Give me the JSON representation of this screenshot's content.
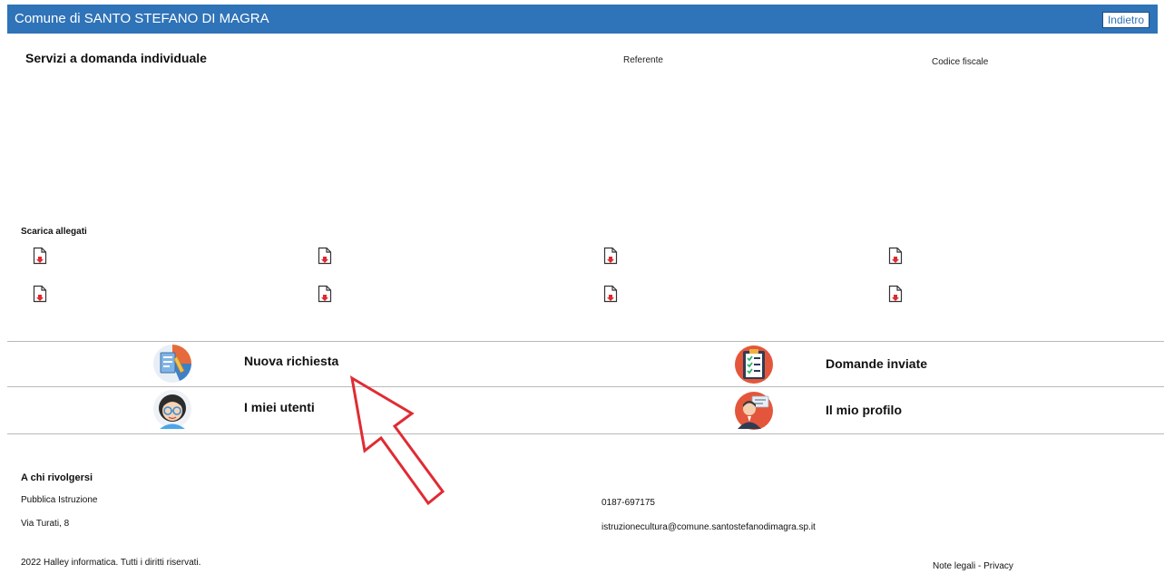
{
  "header": {
    "title": "Comune di SANTO STEFANO DI MAGRA",
    "back_label": "Indietro",
    "color": "#2f73b8"
  },
  "service": {
    "title": "Servizi a domanda individuale",
    "col_referente": "Referente",
    "col_codice_fiscale": "Codice fiscale"
  },
  "attachments": {
    "label": "Scarica allegati",
    "icon": "pdf-download-icon",
    "rows": 2,
    "cols": 4
  },
  "menu": {
    "nuova_richiesta": "Nuova richiesta",
    "domande_inviate": "Domande inviate",
    "miei_utenti": "I miei utenti",
    "mio_profilo": "Il mio profilo"
  },
  "contact": {
    "heading": "A chi rivolgersi",
    "office": "Pubblica Istruzione",
    "address": "Via Turati, 8",
    "phone": "0187-697175",
    "email": "istruzionecultura@comune.santostefanodimagra.sp.it"
  },
  "footer": {
    "copyright": "2022 Halley informatica. Tutti i diritti riservati.",
    "legal": "Note legali - Privacy"
  },
  "annotation": {
    "arrow_color": "#e02b33"
  }
}
